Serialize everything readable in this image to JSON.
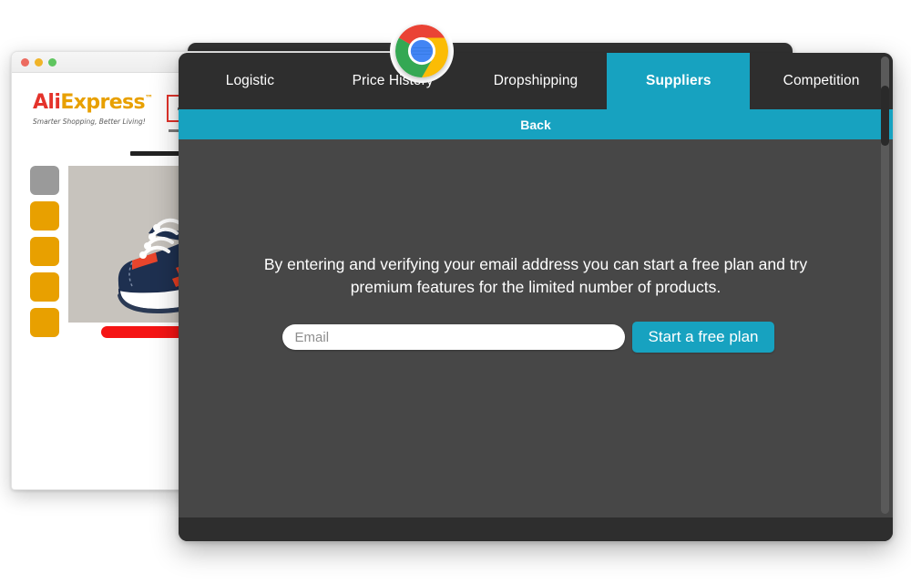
{
  "browser_window": {
    "traffic_lights": [
      "close",
      "minimize",
      "zoom"
    ],
    "site": {
      "logo_part1": "Ali",
      "logo_part2": "Express",
      "logo_tm": "™",
      "tagline": "Smarter Shopping, Better Living!",
      "search_placeholder": ""
    },
    "product": {
      "thumbnails": [
        "selected",
        "thumb",
        "thumb",
        "thumb",
        "thumb"
      ],
      "image_alt": "navy blue running sneaker with red stripes"
    }
  },
  "extension": {
    "tabs": [
      {
        "label": "Logistic",
        "active": false
      },
      {
        "label": "Price History",
        "active": false
      },
      {
        "label": "Dropshipping",
        "active": false
      },
      {
        "label": "Suppliers",
        "active": true
      },
      {
        "label": "Competition",
        "active": false
      }
    ],
    "back_label": "Back",
    "message": "By entering and verifying your email address you can start a free plan and try premium features for the limited number of products.",
    "email_placeholder": "Email",
    "email_value": "",
    "submit_label": "Start a free plan"
  },
  "chrome_icon": {
    "name": "chrome-logo",
    "colors": {
      "red": "#EA4335",
      "yellow": "#FBBC05",
      "green": "#34A853",
      "blue": "#4285F4"
    }
  },
  "colors": {
    "accent_teal": "#17a2c0",
    "panel_bg": "#474747",
    "tabbar_bg": "#2e2e2e",
    "aliexpress_red": "#e4332b",
    "aliexpress_orange": "#e8a000"
  }
}
